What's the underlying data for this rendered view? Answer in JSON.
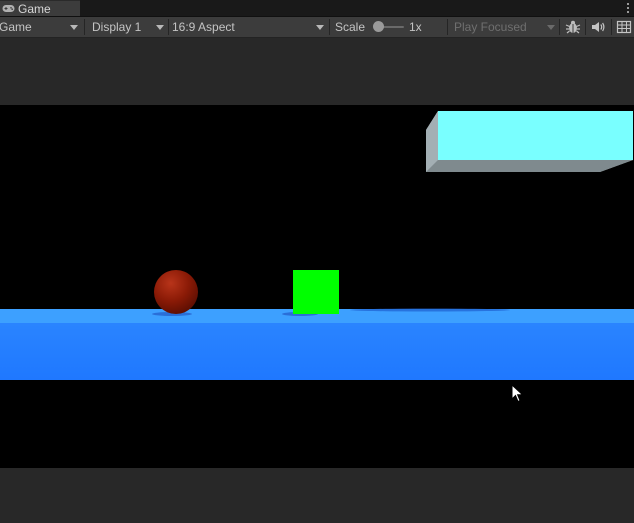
{
  "tab": {
    "label": "Game",
    "icon": "gamepad-icon"
  },
  "toolbar": {
    "mode_select": "Game",
    "display_select": "Display 1",
    "aspect_select": "16:9 Aspect",
    "scale_label": "Scale",
    "scale_value_label": "1x",
    "scale_value": 1,
    "play_mode_select": "Play Focused",
    "icons": [
      "bug-icon",
      "speaker-icon",
      "stats-grid-icon"
    ]
  },
  "colors": {
    "window_bg": "#282828",
    "toolbar_bg": "#3c3c3c",
    "game_bg": "#000000",
    "floor_top": "#3da0ff",
    "floor_front": "#1f78ff",
    "platform_face": "#79ffff",
    "platform_side": "#9ea8ad",
    "platform_bottom": "#7f8a8e",
    "cube": "#00ff00",
    "ball": "#8a1a06"
  }
}
